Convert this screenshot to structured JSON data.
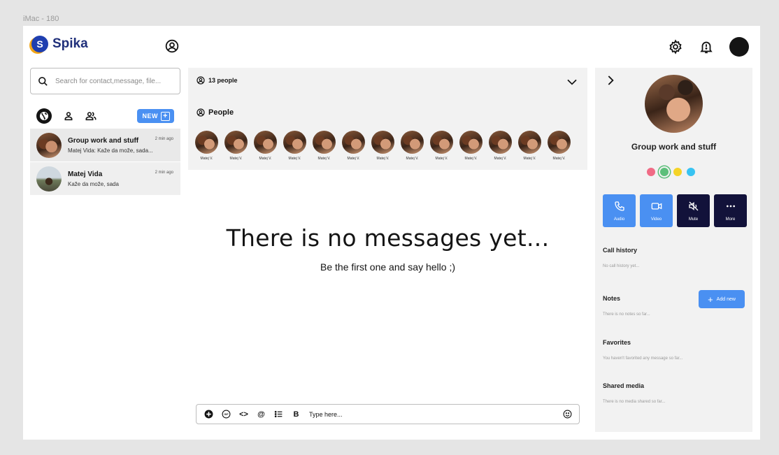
{
  "frame_label": "iMac - 180",
  "app": {
    "logo_letter": "S",
    "name": "Spika"
  },
  "search": {
    "placeholder": "Search for contact,message, file..."
  },
  "filters": {
    "new_label": "NEW"
  },
  "chats": [
    {
      "name": "Group work and stuff",
      "last": "Matej Vida: Kaže da može, sada...",
      "time": "2 min ago",
      "active": true
    },
    {
      "name": "Matej Vida",
      "last": "Kaže da može, sada",
      "time": "2 min ago",
      "active": false
    }
  ],
  "people_panel": {
    "count_label": "13 people",
    "title": "People",
    "members": [
      "Matej V.",
      "Matej V.",
      "Matej V.",
      "Matej V.",
      "Matej V.",
      "Matej V.",
      "Matej V.",
      "Matej V.",
      "Matej V.",
      "Matej V.",
      "Matej V.",
      "Matej V.",
      "Matej V."
    ]
  },
  "empty_state": {
    "title": "There is no messages yet...",
    "subtitle": "Be the first one and say hello ;)"
  },
  "composer": {
    "placeholder": "Type here...",
    "bold_label": "B",
    "code_label": "<>",
    "mention_label": "@"
  },
  "details": {
    "group_name": "Group work and stuff",
    "colors": [
      "#f06b85",
      "#5cbf7a",
      "#f5d327",
      "#38c3f2"
    ],
    "selected_color": 1,
    "actions": [
      {
        "label": "Audio",
        "style": "blue",
        "icon": "phone-icon"
      },
      {
        "label": "Video",
        "style": "blue",
        "icon": "video-icon"
      },
      {
        "label": "Mute",
        "style": "dark",
        "icon": "mute-icon"
      },
      {
        "label": "More",
        "style": "dark",
        "icon": "more-icon"
      }
    ],
    "call_history": {
      "title": "Call history",
      "empty": "No call history yet..."
    },
    "notes": {
      "title": "Notes",
      "empty": "There is no notes so far...",
      "add_label": "Add new"
    },
    "favorites": {
      "title": "Favorites",
      "empty": "You haven't favorited any message so far..."
    },
    "shared_media": {
      "title": "Shared media",
      "empty": "There is no media shared so far..."
    }
  }
}
